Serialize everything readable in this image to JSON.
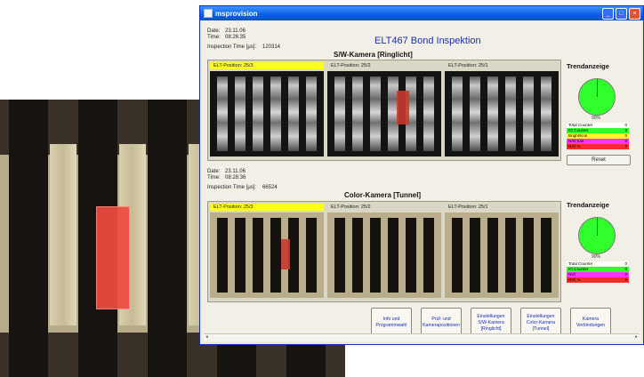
{
  "window": {
    "title": "msprovision"
  },
  "header": {
    "heading": "ELT467 Bond Inspektion"
  },
  "sw_section": {
    "date_label": "Date:",
    "date_value": "23.11.06",
    "time_label": "Time:",
    "time_value": "08:26:35",
    "inspection_time_label": "Inspection Time [µs]:",
    "inspection_time_value": "120314",
    "camera_title": "S/W-Kamera [Ringlicht]",
    "positions": [
      "ELT-Position: 25/3",
      "ELT-Position: 25/2",
      "ELT-Position: 25/1"
    ],
    "trend_title": "Trendanzeige",
    "pie_label": "90%",
    "counters": [
      {
        "label": "Total Counter",
        "value": "0"
      },
      {
        "label": "IO Counter",
        "value": "0"
      },
      {
        "label": "Bright/Kos",
        "value": "0"
      },
      {
        "label": "NIO Kos",
        "value": "0"
      },
      {
        "label": "NIO %",
        "value": "0"
      }
    ],
    "reset_label": "Reset"
  },
  "color_section": {
    "date_label": "Date:",
    "date_value": "23.11.06",
    "time_label": "Time:",
    "time_value": "08:28:36",
    "inspection_time_label": "Inspection Time [µs]:",
    "inspection_time_value": "66524",
    "camera_title": "Color-Kamera [Tunnel]",
    "positions": [
      "ELT-Position: 25/3",
      "ELT-Position: 25/2",
      "ELT-Position: 25/1"
    ],
    "trend_title": "Trendanzeige",
    "pie_label": "90%",
    "counters": [
      {
        "label": "Total Counter",
        "value": "0"
      },
      {
        "label": "IO Counter",
        "value": "0"
      },
      {
        "label": "NIO",
        "value": "0"
      },
      {
        "label": "NIO %",
        "value": "0"
      }
    ]
  },
  "nav_buttons": [
    "Info und Programmwahl",
    "Prüf- und Kamerapositionen",
    "Einstellungen S/W-Kamera [Ringlicht]",
    "Einstellungen Color-Kamera [Tunnel]",
    "Kamera Verbindungen"
  ],
  "colors": {
    "title_bar": "#0a5fe0",
    "heading": "#1a2fb5",
    "highlight_yellow": "#ffff22",
    "pie_green": "#31ff2c",
    "defect_red": "#c93a2e",
    "counter_io": "#31ff2c",
    "counter_warn": "#ffff22",
    "counter_nio": "#ff33ff",
    "counter_pct": "#ff2b2b"
  }
}
